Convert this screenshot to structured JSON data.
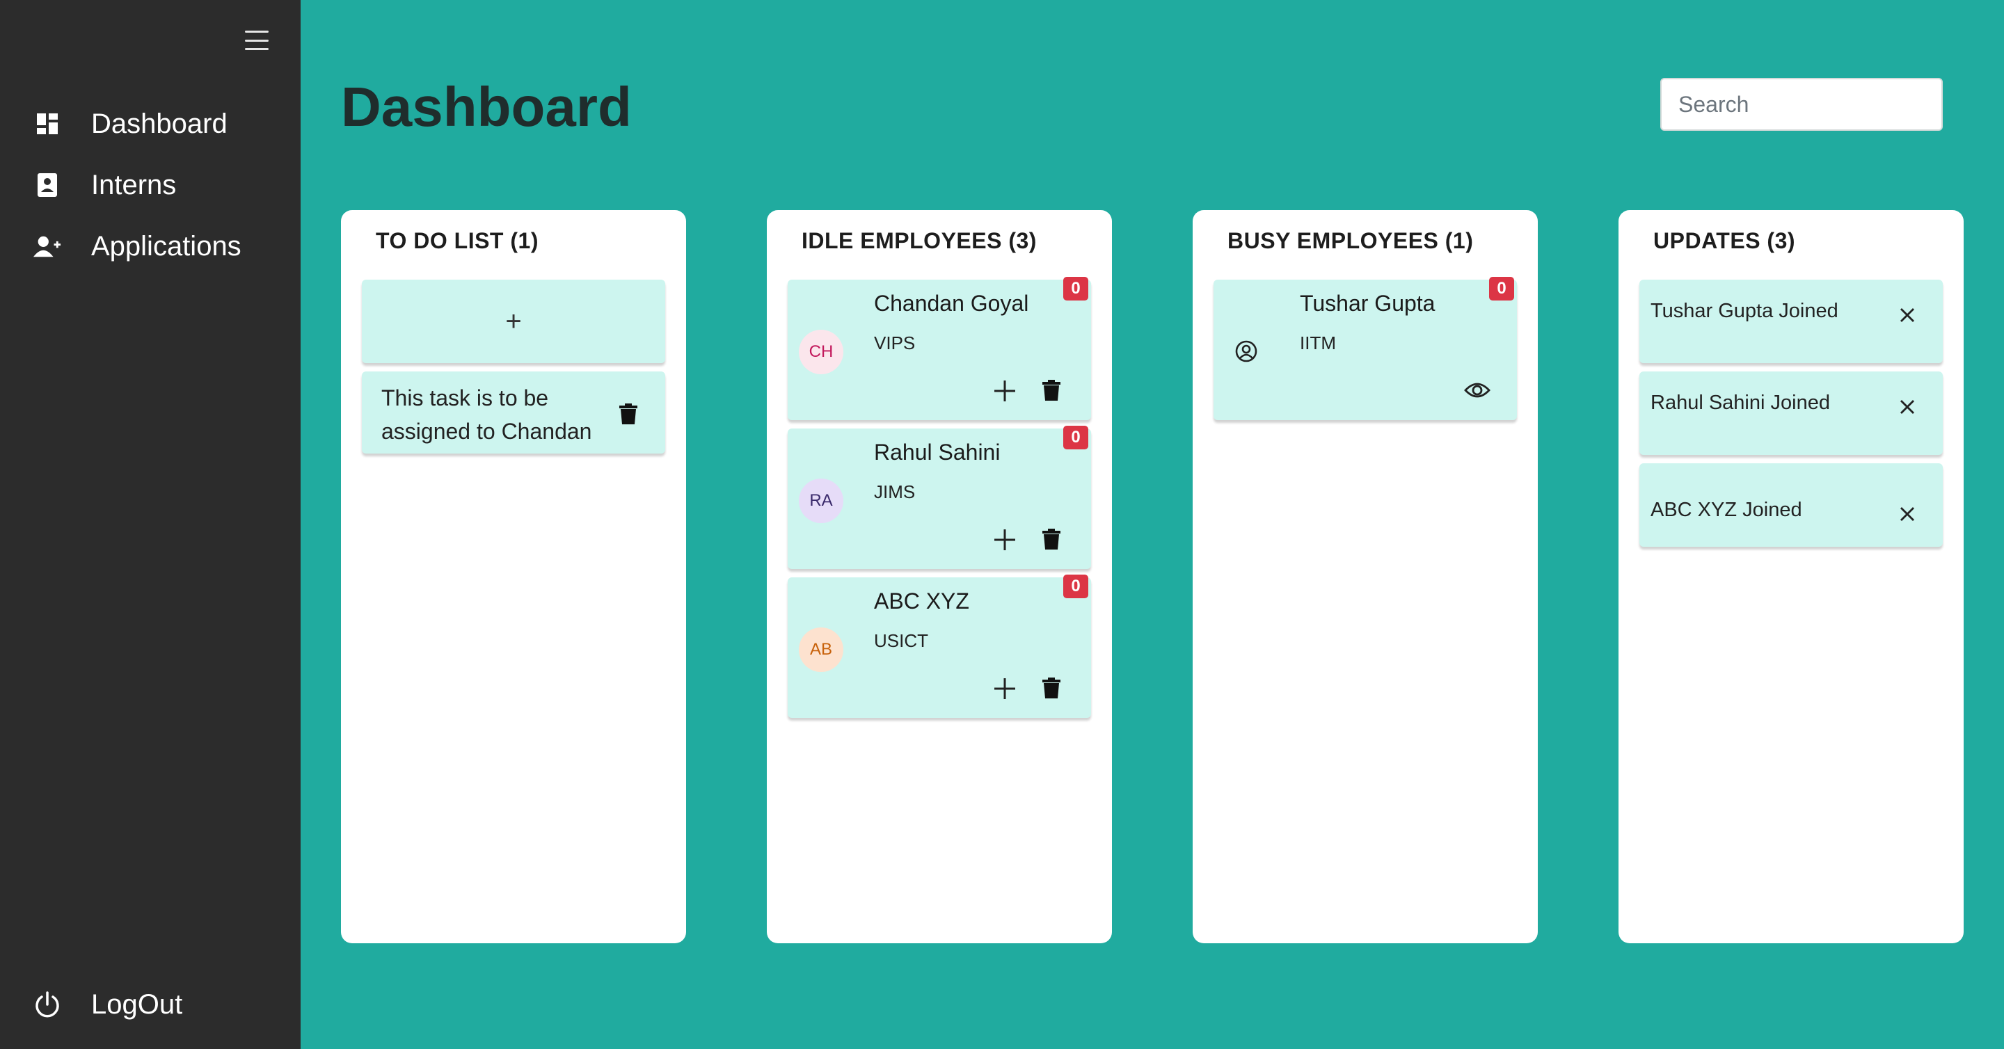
{
  "sidebar": {
    "items": [
      {
        "label": "Dashboard",
        "icon": "dashboard-icon"
      },
      {
        "label": "Interns",
        "icon": "id-badge-icon"
      },
      {
        "label": "Applications",
        "icon": "user-plus-icon"
      }
    ],
    "logout_label": "LogOut"
  },
  "header": {
    "title": "Dashboard",
    "search_placeholder": "Search"
  },
  "columns": {
    "todo": {
      "title": "TO DO LIST (1)",
      "add_label": "+",
      "tasks": [
        {
          "text": "This task is to be assigned to Chandan"
        }
      ]
    },
    "idle": {
      "title": "IDLE EMPLOYEES (3)",
      "employees": [
        {
          "name": "Chandan Goyal",
          "college": "VIPS",
          "initials": "CH",
          "badge": "0",
          "avatar_bg": "#fbe6ec",
          "avatar_color": "#c2185b"
        },
        {
          "name": "Rahul Sahini",
          "college": "JIMS",
          "initials": "RA",
          "badge": "0",
          "avatar_bg": "#e6dcf8",
          "avatar_color": "#3a2a6b"
        },
        {
          "name": "ABC XYZ",
          "college": "USICT",
          "initials": "AB",
          "badge": "0",
          "avatar_bg": "#fde2cf",
          "avatar_color": "#c8620b"
        }
      ]
    },
    "busy": {
      "title": "BUSY EMPLOYEES (1)",
      "employees": [
        {
          "name": "Tushar Gupta",
          "college": "IITM",
          "badge": "0"
        }
      ]
    },
    "updates": {
      "title": "UPDATES (3)",
      "items": [
        {
          "text": "Tushar Gupta Joined"
        },
        {
          "text": "Rahul Sahini Joined"
        },
        {
          "text": "ABC XYZ Joined"
        }
      ]
    }
  },
  "colors": {
    "background": "#20ab9f",
    "sidebar": "#2c2c2c",
    "card": "#cdf5ef",
    "badge": "#dc3545"
  }
}
